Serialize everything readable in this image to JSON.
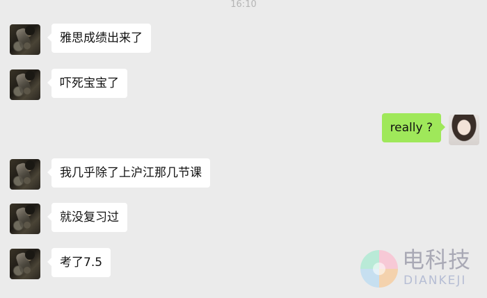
{
  "header": {
    "timestamp": "16:10"
  },
  "messages": [
    {
      "side": "left",
      "text": "雅思成绩出来了"
    },
    {
      "side": "left",
      "text": "吓死宝宝了"
    },
    {
      "side": "right",
      "text": "really ?"
    },
    {
      "side": "left",
      "text": "我几乎除了上沪江那几节课"
    },
    {
      "side": "left",
      "text": "就没复习过"
    },
    {
      "side": "left",
      "text": "考了7.5"
    }
  ],
  "watermark": {
    "cn": "电科技",
    "en": "DIANKEJI"
  },
  "colors": {
    "background": "#ebebeb",
    "bubble_in": "#ffffff",
    "bubble_out": "#9fe85a"
  }
}
